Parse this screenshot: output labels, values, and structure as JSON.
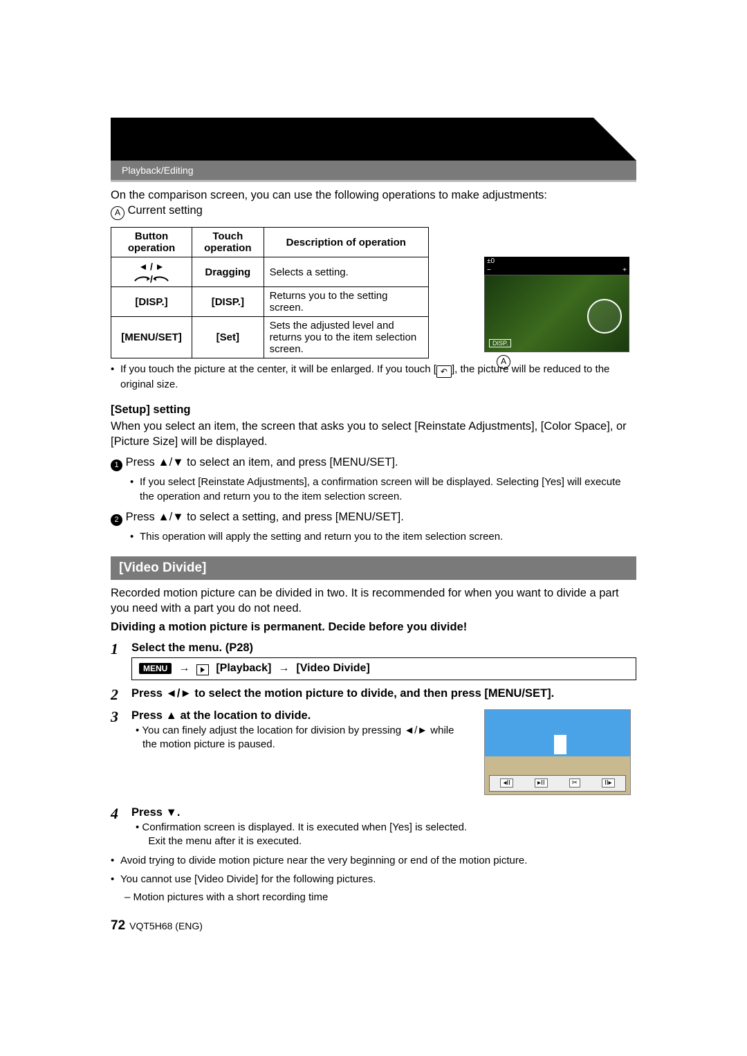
{
  "header": {
    "breadcrumb": "Playback/Editing"
  },
  "intro": {
    "line1": "On the comparison screen, you can use the following operations to make adjustments:",
    "current_setting": " Current setting"
  },
  "table": {
    "h1": "Button operation",
    "h2": "Touch operation",
    "h3": "Description of operation",
    "r1_touch": "Dragging",
    "r1_desc": "Selects a setting.",
    "r2_btn": "[DISP.]",
    "r2_touch": "[DISP.]",
    "r2_desc": "Returns you to the setting screen.",
    "r3_btn": "[MENU/SET]",
    "r3_touch": "[Set]",
    "r3_desc": "Sets the adjusted level and returns you to the item selection screen."
  },
  "comp": {
    "bar_l": "±0",
    "bar_minus": "−",
    "bar_plus": "+",
    "disp": "DISP."
  },
  "note1_a": "If you touch the picture at the center, it will be enlarged. If you touch [",
  "note1_b": "], the picture will be reduced to the original size.",
  "setup": {
    "title": "[Setup] setting",
    "p": "When you select an item, the screen that asks you to select [Reinstate Adjustments], [Color Space], or [Picture Size] will be displayed.",
    "s1": " Press ▲/▼ to select an item, and press [MENU/SET].",
    "s1sub": "If you select [Reinstate Adjustments], a confirmation screen will be displayed. Selecting [Yes] will execute the operation and return you to the item selection screen.",
    "s2": " Press ▲/▼ to select a setting, and press [MENU/SET].",
    "s2sub": "This operation will apply the setting and return you to the item selection screen."
  },
  "vd": {
    "title": "[Video Divide]",
    "p": "Recorded motion picture can be divided in two. It is recommended for when you want to divide a part you need with a part you do not need.",
    "warn": "Dividing a motion picture is permanent. Decide before you divide!",
    "step1": "Select the menu. (P28)",
    "menu_path_a": "[Playback]",
    "menu_path_b": "[Video Divide]",
    "step2": "Press ◄/► to select the motion picture to divide, and then press [MENU/SET].",
    "step3": "Press ▲ at the location to divide.",
    "step3_sub": "You can finely adjust the location for division by pressing ◄/► while the motion picture is paused.",
    "step4": "Press ▼.",
    "step4_sub1": "Confirmation screen is displayed. It is executed when [Yes] is selected.",
    "step4_sub2": "Exit the menu after it is executed.",
    "b1": "Avoid trying to divide motion picture near the very beginning or end of the motion picture.",
    "b2": "You cannot use [Video Divide] for the following pictures.",
    "b2a": "Motion pictures with a short recording time"
  },
  "footer": {
    "page": "72",
    "code": "VQT5H68 (ENG)"
  }
}
